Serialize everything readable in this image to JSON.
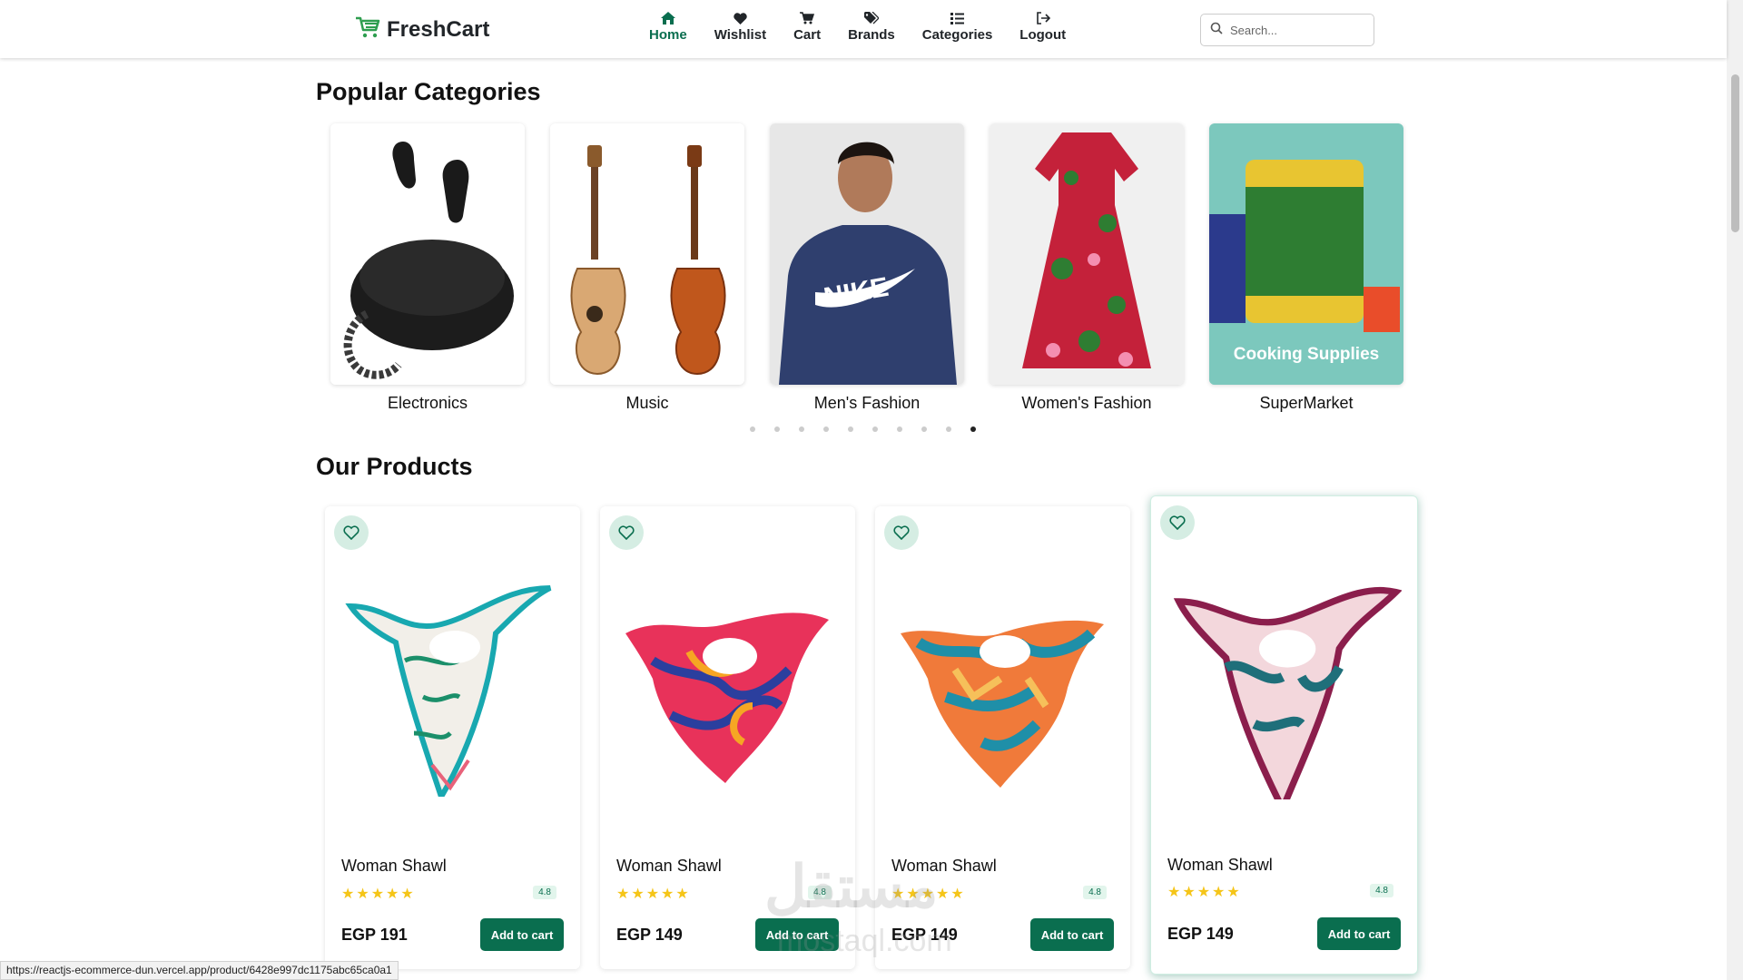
{
  "nav": {
    "logo_text": "FreshCart",
    "links": [
      {
        "label": "Home",
        "icon": "home-icon",
        "active": true
      },
      {
        "label": "Wishlist",
        "icon": "heart-icon",
        "active": false
      },
      {
        "label": "Cart",
        "icon": "cart-icon",
        "active": false
      },
      {
        "label": "Brands",
        "icon": "tag-icon",
        "active": false
      },
      {
        "label": "Categories",
        "icon": "list-icon",
        "active": false
      },
      {
        "label": "Logout",
        "icon": "logout-icon",
        "active": false
      }
    ],
    "search_placeholder": "Search..."
  },
  "categories_section": {
    "title": "Popular Categories",
    "items": [
      {
        "label": "Electronics"
      },
      {
        "label": "Music"
      },
      {
        "label": "Men's Fashion"
      },
      {
        "label": "Women's Fashion"
      },
      {
        "label": "SuperMarket",
        "overlay_text": "Cooking Supplies"
      }
    ],
    "dots": 10,
    "active_dot": 9
  },
  "products_section": {
    "title": "Our Products",
    "items": [
      {
        "name": "Woman Shawl",
        "rating": "4.8",
        "price": "EGP 191",
        "button": "Add to cart"
      },
      {
        "name": "Woman Shawl",
        "rating": "4.8",
        "price": "EGP 149",
        "button": "Add to cart"
      },
      {
        "name": "Woman Shawl",
        "rating": "4.8",
        "price": "EGP 149",
        "button": "Add to cart"
      },
      {
        "name": "Woman Shawl",
        "rating": "4.8",
        "price": "EGP 149",
        "button": "Add to cart"
      }
    ]
  },
  "status_bar": {
    "url": "https://reactjs-ecommerce-dun.vercel.app/product/6428e997dc1175abc65ca0a1"
  },
  "watermark": {
    "text": "مستقل",
    "subtext": "mostaql.com"
  },
  "colors": {
    "brand": "#0a6e4f",
    "logo_icon": "#2e9e4f",
    "star": "#f5c518"
  }
}
